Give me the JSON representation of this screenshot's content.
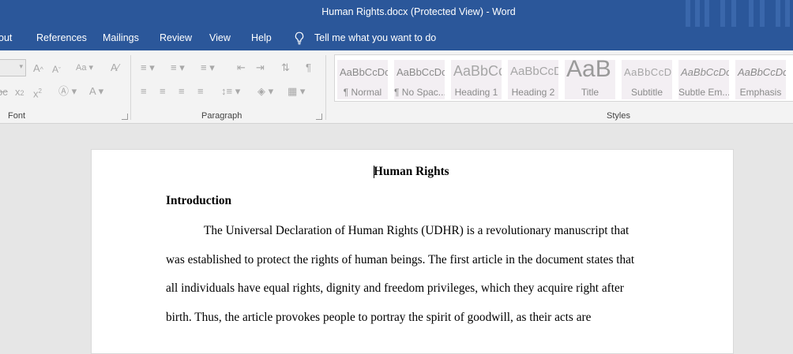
{
  "window": {
    "title": "Human Rights.docx (Protected View)  -  Word"
  },
  "menu": {
    "tabs": [
      "out",
      "References",
      "Mailings",
      "Review",
      "View",
      "Help"
    ],
    "tell_me": "Tell me what you want to do"
  },
  "ribbon": {
    "font_group": "Font",
    "paragraph_group": "Paragraph",
    "styles_group": "Styles",
    "styles": [
      {
        "sample": "AaBbCcDc",
        "name": "¶ Normal"
      },
      {
        "sample": "AaBbCcDc",
        "name": "¶ No Spac..."
      },
      {
        "sample": "AaBbCc",
        "name": "Heading 1"
      },
      {
        "sample": "AaBbCcD",
        "name": "Heading 2"
      },
      {
        "sample": "AaB",
        "name": "Title"
      },
      {
        "sample": "AaBbCcD",
        "name": "Subtitle"
      },
      {
        "sample": "AaBbCcDc",
        "name": "Subtle Em..."
      },
      {
        "sample": "AaBbCcDc",
        "name": "Emphasis"
      }
    ]
  },
  "document": {
    "title": "Human Rights",
    "heading": "Introduction",
    "lines": [
      "The Universal Declaration of Human Rights (UDHR) is a revolutionary manuscript that",
      "was established to protect the rights of human beings. The first article in the document states that",
      "all individuals have equal rights, dignity and freedom privileges, which they acquire right after",
      "birth. Thus, the article provokes people to portray the spirit of goodwill, as their acts are"
    ]
  }
}
